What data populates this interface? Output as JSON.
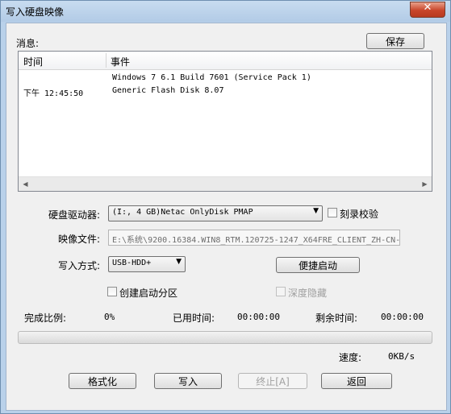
{
  "window": {
    "title": "写入硬盘映像",
    "close_glyph": "✕"
  },
  "messages": {
    "label": "消息:",
    "save_button": "保存",
    "columns": {
      "time": "时间",
      "event": "事件"
    },
    "rows": [
      {
        "time": "",
        "event": "Windows 7 6.1 Build 7601 (Service Pack 1)"
      },
      {
        "time": "下午 12:45:50",
        "event": "Generic Flash Disk      8.07"
      }
    ],
    "scroll_left_glyph": "◀",
    "scroll_right_glyph": "▶"
  },
  "drive": {
    "label": "硬盘驱动器:",
    "value": "(I:, 4 GB)Netac   OnlyDisk        PMAP",
    "verify_label": "刻录校验",
    "verify_checked": false
  },
  "image_file": {
    "label": "映像文件:",
    "value": "E:\\系统\\9200.16384.WIN8_RTM.120725-1247_X64FRE_CLIENT_ZH-CN-"
  },
  "write_mode": {
    "label": "写入方式:",
    "value": "USB-HDD+",
    "boot_button": "便捷启动"
  },
  "options": {
    "create_boot_partition_label": "创建启动分区",
    "create_boot_partition_checked": false,
    "deep_hide_label": "深度隐藏",
    "deep_hide_checked": false,
    "deep_hide_enabled": false
  },
  "progress": {
    "complete_label": "完成比例:",
    "complete_value": "0%",
    "fraction": 0,
    "elapsed_label": "已用时间:",
    "elapsed_value": "00:00:00",
    "remaining_label": "剩余时间:",
    "remaining_value": "00:00:00",
    "speed_label": "速度:",
    "speed_value": "0KB/s"
  },
  "buttons": {
    "format": "格式化",
    "write": "写入",
    "abort": "终止[A]",
    "back": "返回"
  },
  "dropdown_glyph": "▼"
}
